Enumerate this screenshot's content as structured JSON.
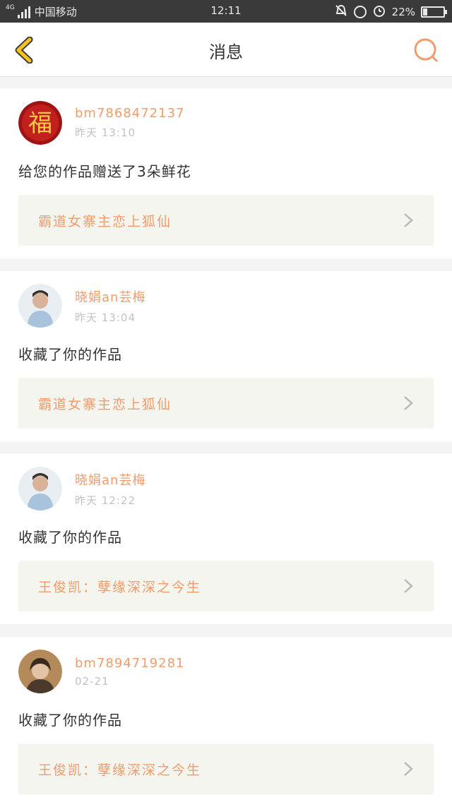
{
  "status_bar": {
    "network": "4G",
    "carrier": "中国移动",
    "time": "12:11",
    "battery": "22%",
    "battery_level": 0.22
  },
  "header": {
    "title": "消息"
  },
  "messages": [
    {
      "user": "bm7868472137",
      "date": "昨天 13:10",
      "text": "给您的作品赠送了3朵鲜花",
      "work_title": "霸道女寨主恋上狐仙",
      "avatar_char": "福"
    },
    {
      "user": "晓娟an芸梅",
      "date": "昨天 13:04",
      "text": "收藏了你的作品",
      "work_title": "霸道女寨主恋上狐仙"
    },
    {
      "user": "晓娟an芸梅",
      "date": "昨天 12:22",
      "text": "收藏了你的作品",
      "work_title": "王俊凯：孽缘深深之今生"
    },
    {
      "user": "bm7894719281",
      "date": "02-21",
      "text": "收藏了你的作品",
      "work_title": "王俊凯：孽缘深深之今生"
    }
  ],
  "colors": {
    "accent": "#f09c6c",
    "back_icon": "#f5c31d"
  }
}
